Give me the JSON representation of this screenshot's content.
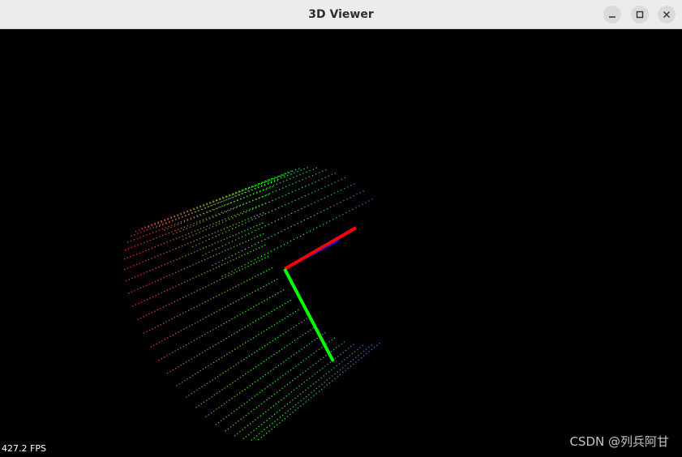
{
  "window": {
    "title": "3D Viewer",
    "controls": {
      "minimize": "minimize-icon",
      "maximize": "maximize-icon",
      "close": "close-icon"
    }
  },
  "viewport": {
    "background": "#000000",
    "fps_label": "427.2 FPS",
    "watermark": "CSDN @列兵阿甘"
  },
  "point_cloud": {
    "shape": "cylinder",
    "color_gradient": [
      "#ff3030",
      "#20ff20",
      "#3050ff"
    ]
  },
  "axes": {
    "x_color": "#ff0000",
    "y_color": "#00ff00",
    "z_color": "#0000ff"
  }
}
